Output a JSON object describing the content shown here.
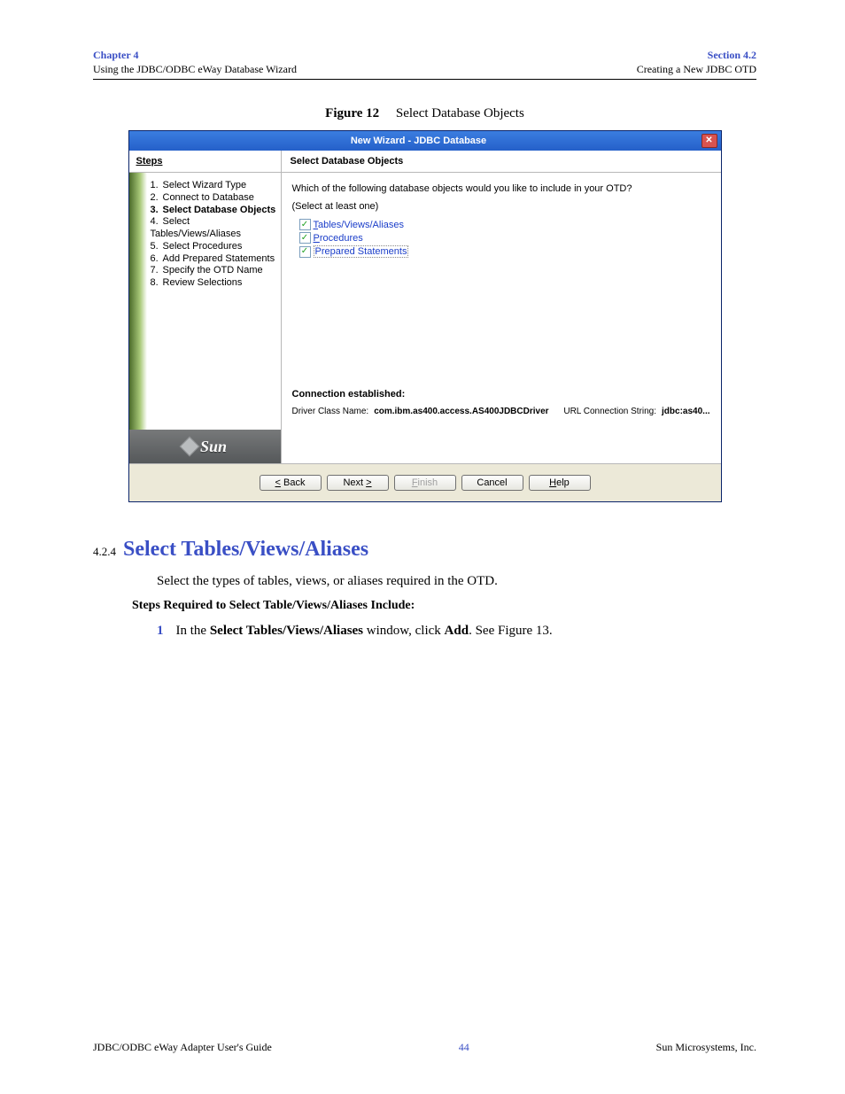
{
  "header": {
    "chapter": "Chapter 4",
    "chapter_title": "Using the JDBC/ODBC eWay Database Wizard",
    "section": "Section 4.2",
    "section_title": "Creating a New JDBC OTD"
  },
  "figure_caption": {
    "label": "Figure 12",
    "title": "Select Database Objects"
  },
  "dialog": {
    "title": "New Wizard - JDBC Database",
    "steps_header": "Steps",
    "steps": [
      {
        "n": "1.",
        "label": "Select Wizard Type"
      },
      {
        "n": "2.",
        "label": "Connect to Database"
      },
      {
        "n": "3.",
        "label": "Select Database Objects",
        "current": true
      },
      {
        "n": "4.",
        "label": "Select Tables/Views/Aliases"
      },
      {
        "n": "5.",
        "label": "Select Procedures"
      },
      {
        "n": "6.",
        "label": "Add Prepared Statements"
      },
      {
        "n": "7.",
        "label": "Specify the OTD Name"
      },
      {
        "n": "8.",
        "label": "Review Selections"
      }
    ],
    "main_header": "Select Database Objects",
    "question": "Which of the following database objects would you like to include in your OTD?",
    "instruction": "(Select at least one)",
    "checkboxes": [
      {
        "pre": "T",
        "label": "ables/Views/Aliases",
        "checked": true
      },
      {
        "pre": "P",
        "label": "rocedures",
        "checked": true
      },
      {
        "pre": "",
        "label": "Prepared Statements",
        "checked": true,
        "selected": true
      }
    ],
    "connection": {
      "header": "Connection established:",
      "driver_label": "Driver Class Name:",
      "driver_value": "com.ibm.as400.access.AS400JDBCDriver",
      "url_label": "URL Connection String:",
      "url_value": "jdbc:as40..."
    },
    "buttons": {
      "back": "< Back",
      "next": "Next >",
      "finish_pre": "F",
      "finish_rest": "inish",
      "cancel": "Cancel",
      "help_pre": "H",
      "help_rest": "elp"
    }
  },
  "section424": {
    "num": "4.2.4",
    "title": "Select Tables/Views/Aliases",
    "intro": "Select the types of tables, views, or aliases required in the OTD.",
    "steps_intro": "Steps Required to Select Table/Views/Aliases Include:",
    "step1_num": "1",
    "step1_a": "In the ",
    "step1_b": "Select Tables/Views/Aliases",
    "step1_c": " window, click ",
    "step1_d": "Add",
    "step1_e": ". See Figure 13."
  },
  "footer": {
    "left": "JDBC/ODBC eWay Adapter User's Guide",
    "center": "44",
    "right": "Sun Microsystems, Inc."
  }
}
